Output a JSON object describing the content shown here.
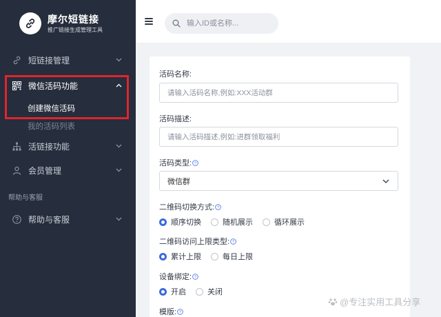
{
  "brand": {
    "title": "摩尔短链接",
    "subtitle": "推广链接生成管理工具"
  },
  "sidebar": {
    "items": [
      {
        "label": "短链接管理",
        "icon": "link-icon"
      },
      {
        "label": "微信活码功能",
        "icon": "qrcode-icon",
        "expanded": true
      },
      {
        "label": "活链接功能",
        "icon": "sitemap-icon"
      },
      {
        "label": "会员管理",
        "icon": "user-icon"
      },
      {
        "label": "帮助与客服",
        "icon": "help-circle-icon"
      }
    ],
    "submenu": {
      "create": "创建微信活码",
      "list": "我的活码列表"
    },
    "section": "帮助与客服"
  },
  "search": {
    "placeholder": "输入ID或名称..."
  },
  "form": {
    "name_label": "活码名称:",
    "name_placeholder": "请输入活码名称,例如:XXX活动群",
    "desc_label": "活码描述:",
    "desc_placeholder": "请输入活码描述,例如:进群领取福利",
    "type_label": "活码类型:",
    "type_value": "微信群",
    "switch_label": "二维码切换方式:",
    "switch_options": [
      "顺序切换",
      "随机展示",
      "循环展示"
    ],
    "switch_selected": 0,
    "limit_label": "二维码访问上限类型:",
    "limit_options": [
      "累计上限",
      "每日上限"
    ],
    "limit_selected": 0,
    "device_label": "设备绑定:",
    "device_options": [
      "开启",
      "关闭"
    ],
    "device_selected": 0,
    "template_label": "模版:"
  },
  "watermark": "@专注实用工具分享",
  "colors": {
    "sidebar_bg": "#262d3c",
    "accent": "#3b6ae0",
    "highlight": "#e0252c"
  }
}
